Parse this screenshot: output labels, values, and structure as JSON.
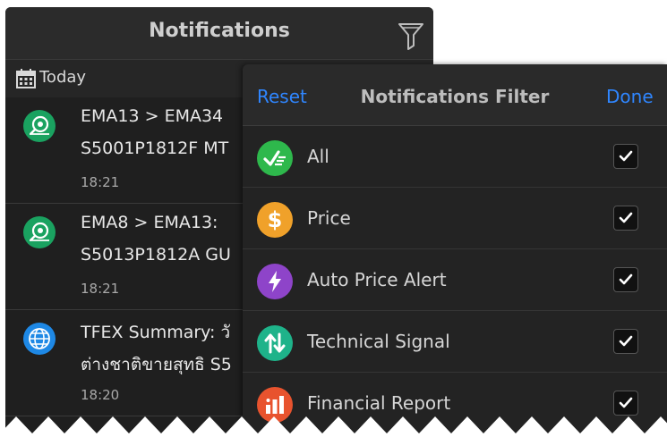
{
  "header": {
    "title": "Notifications",
    "filter_icon": "funnel-icon"
  },
  "date_group": {
    "label": "Today",
    "icon": "calendar-icon"
  },
  "notifications": [
    {
      "icon": "signal-eye-icon",
      "icon_color": "#1aa260",
      "line1": "EMA13 > EMA34",
      "line2": "S5001P1812F MT",
      "time": "18:21"
    },
    {
      "icon": "signal-eye-icon",
      "icon_color": "#1aa260",
      "line1": "EMA8 > EMA13: ",
      "line2": "S5013P1812A GU",
      "time": "18:21"
    },
    {
      "icon": "globe-icon",
      "icon_color": "#1e88e5",
      "line1": "TFEX Summary: วั",
      "line2": "ต่างชาติขายสุทธิ S5",
      "time": "18:20"
    }
  ],
  "filter": {
    "reset_label": "Reset",
    "title": "Notifications Filter",
    "done_label": "Done",
    "accent": "#2f86ff",
    "items": [
      {
        "label": "All",
        "icon": "check-list-icon",
        "color": "#2eb84c",
        "checked": true
      },
      {
        "label": "Price",
        "icon": "dollar-icon",
        "color": "#f0a12a",
        "checked": true
      },
      {
        "label": "Auto Price Alert",
        "icon": "lightning-icon",
        "color": "#8e44c9",
        "checked": true
      },
      {
        "label": "Technical Signal",
        "icon": "up-down-arrows-icon",
        "color": "#1eb38a",
        "checked": true
      },
      {
        "label": "Financial Report",
        "icon": "bar-chart-icon",
        "color": "#e8532e",
        "checked": true
      }
    ]
  }
}
